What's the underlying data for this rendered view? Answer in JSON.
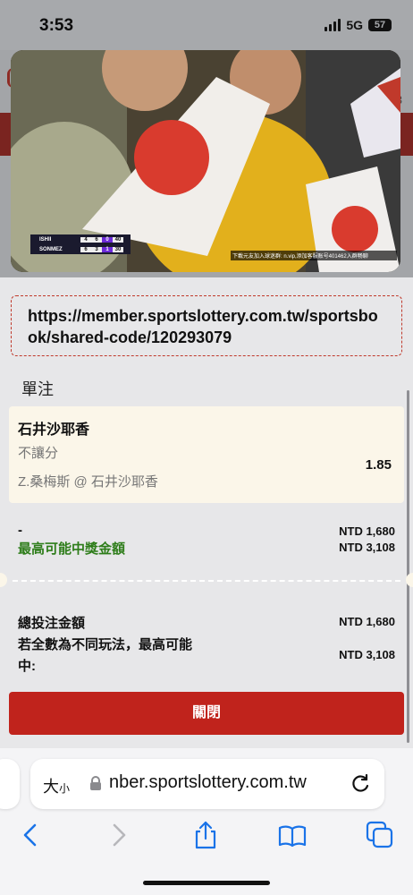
{
  "status_bar": {
    "time": "3:53",
    "network": "5G",
    "battery": "57"
  },
  "video": {
    "scoreboard": [
      {
        "player": "ISHII",
        "set1": "4",
        "set2": "6",
        "set3": "0",
        "game": "40"
      },
      {
        "player": "SONMEZ",
        "set1": "6",
        "set2": "3",
        "set3": "1",
        "game": "30"
      }
    ],
    "ticker": "下載元友加入球迷群: n.vip,添加客服账号401462入群畅聊"
  },
  "share_link": "https://member.sportslottery.com.tw/sportsbook/shared-code/120293079",
  "section_title": "單注",
  "bet": {
    "selection": "石井沙耶香",
    "market": "不讓分",
    "match": "Z.桑梅斯 @ 石井沙耶香",
    "odds": "1.85"
  },
  "stake": {
    "label": "-",
    "amount": "NTD 1,680"
  },
  "max_win": {
    "label": "最高可能中獎金額",
    "amount": "NTD 3,108"
  },
  "summary": {
    "total_label": "總投注金額",
    "total_amount": "NTD 1,680",
    "alt_label": "若全數為不同玩法，最高可能中:",
    "alt_amount": "NTD 3,108"
  },
  "close_button": "關閉",
  "browser": {
    "text_size_label": "大",
    "text_size_small": "小",
    "url": "nber.sportslottery.com.tw"
  },
  "background_page": {
    "partial_number": "3"
  },
  "colors": {
    "accent_red": "#c0231c",
    "prize_green": "#2e7d1a",
    "link_border": "#c0392b",
    "card_bg": "#fbf6e9"
  },
  "icons": [
    "signal-icon",
    "battery-icon",
    "lock-icon",
    "reload-icon",
    "back-icon",
    "forward-icon",
    "share-icon",
    "bookmarks-icon",
    "tabs-icon"
  ]
}
